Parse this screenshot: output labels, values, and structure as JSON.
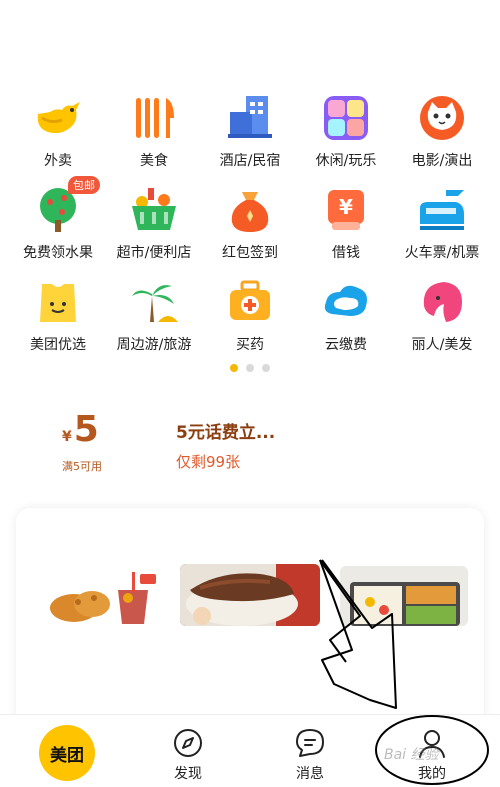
{
  "grid": {
    "rows": [
      [
        {
          "label": "外卖",
          "icon": "kangaroo-icon"
        },
        {
          "label": "美食",
          "icon": "fork-knife-icon"
        },
        {
          "label": "酒店/民宿",
          "icon": "building-icon"
        },
        {
          "label": "休闲/玩乐",
          "icon": "leisure-grid-icon"
        },
        {
          "label": "电影/演出",
          "icon": "cat-icon"
        }
      ],
      [
        {
          "label": "免费领水果",
          "icon": "tree-icon",
          "badge": "包邮"
        },
        {
          "label": "超市/便利店",
          "icon": "basket-icon"
        },
        {
          "label": "红包签到",
          "icon": "money-bag-icon"
        },
        {
          "label": "借钱",
          "icon": "yuan-card-icon"
        },
        {
          "label": "火车票/机票",
          "icon": "train-plane-icon"
        }
      ],
      [
        {
          "label": "美团优选",
          "icon": "shopping-bag-icon"
        },
        {
          "label": "周边游/旅游",
          "icon": "palm-tree-icon"
        },
        {
          "label": "买药",
          "icon": "medicine-box-icon"
        },
        {
          "label": "云缴费",
          "icon": "cloud-icon"
        },
        {
          "label": "丽人/美发",
          "icon": "woman-hair-icon"
        }
      ]
    ]
  },
  "pager": {
    "active": 0,
    "count": 3
  },
  "coupon": {
    "currency": "¥",
    "amount": "5",
    "condition": "满5可用",
    "title": "5元话费立...",
    "remaining": "仅剩99张"
  },
  "tabbar": {
    "home": "美团",
    "discover": "发现",
    "messages": "消息",
    "mine": "我的"
  },
  "watermark": "Bai 经验",
  "colors": {
    "brand": "#ffc300",
    "coupon": "#b5581d",
    "accent": "#e05a2b",
    "dot_active": "#f5b800"
  }
}
